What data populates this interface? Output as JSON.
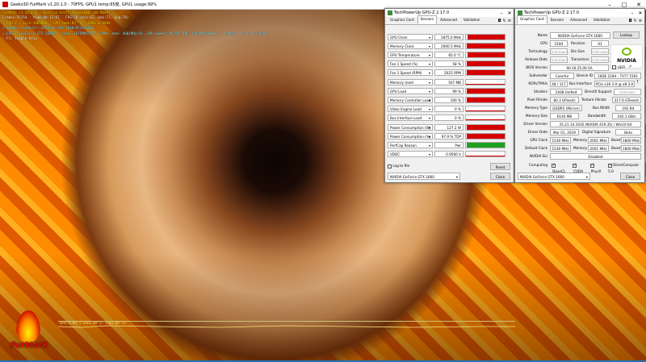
{
  "furmark": {
    "title": "Geeks3D FurMark v1.20.1.0 - 70FPS, GPU1 temp:65度, GPU1 usage:99%",
    "osd_lines": [
      {
        "text": "FurMark v1.20.1.0 - Burn-in test, 1920x1080 (0X MSAA)",
        "color": "osd-y"
      },
      {
        "text": "Frames:55154 - time:00:13:07 - FPS:70 (min:62, max:71, avg:70)",
        "color": "osd-w"
      },
      {
        "text": "[ GPU-Z ] core:1905MHz - GPU temp:65° C - VDDC:0.968V",
        "color": "osd-y"
      },
      {
        "text": "> OpenGL renderer: GeForce GTX 1660/PCIe/SSE2",
        "color": "osd-c"
      },
      {
        "text": "> GPU 1 (GeForce GTX 1660) - core: 1875MHz/65° C/99%, mem: 4001MHz/5%, GPU power: 95.5% TDP, limits[power:1, temp:0, volt:0, OV:0]",
        "color": "osd-c"
      },
      {
        "text": "- F1: toggle help",
        "color": "osd-w"
      }
    ],
    "graph_label": "GPU 1: 65° C (min: 46° C - max: 66° C)",
    "logo_text": "FurMark"
  },
  "gpuz_sensors": {
    "title": "TechPowerUp GPU-Z 2.17.0",
    "tabs": [
      "Graphics Card",
      "Sensors",
      "Advanced",
      "Validation"
    ],
    "active_tab": "Sensors",
    "rows": [
      {
        "name": "GPU Clock",
        "value": "1875.0 MHz",
        "fill": 0.95
      },
      {
        "name": "Memory Clock",
        "value": "2000.5 MHz",
        "fill": 0.97
      },
      {
        "name": "GPU Temperature",
        "value": "65.0 °C",
        "fill": 0.95
      },
      {
        "name": "Fan 1 Speed (%)",
        "value": "58 %",
        "fill": 0.97
      },
      {
        "name": "Fan 1 Speed (RPM)",
        "value": "2025 RPM",
        "fill": 0.97
      },
      {
        "name": "Memory Used",
        "value": "507 MB",
        "fill": 0.0
      },
      {
        "name": "GPU Load",
        "value": "99 %",
        "fill": 0.97
      },
      {
        "name": "Memory Controller Load",
        "value": "100 %",
        "fill": 0.97
      },
      {
        "name": "Video Engine Load",
        "value": "0 %",
        "fill": 0.0
      },
      {
        "name": "Bus Interface Load",
        "value": "0 %",
        "fill": 0.0
      },
      {
        "name": "Power Consumption (W)",
        "value": "127.2 W",
        "fill": 0.97
      },
      {
        "name": "Power Consumption (%)",
        "value": "97.9 % TDP",
        "fill": 0.97
      },
      {
        "name": "PerfCap Reason",
        "value": "Pwr",
        "fill": 0.97,
        "color": "green"
      },
      {
        "name": "VDDC",
        "value": "0.9560 V",
        "fill": 0.0
      }
    ],
    "log_to_file": "Log to file",
    "reset": "Reset",
    "gpu_select": "NVIDIA GeForce GTX 1660",
    "close": "Close"
  },
  "gpuz_card": {
    "title": "TechPowerUp GPU-Z 2.17.0",
    "tabs": [
      "Graphics Card",
      "Sensors",
      "Advanced",
      "Validation"
    ],
    "active_tab": "Graphics Card",
    "name_label": "Name",
    "name_value": "NVIDIA GeForce GTX 1660",
    "lookup": "Lookup",
    "gpu_label": "GPU",
    "gpu_value": "2184",
    "revision_label": "Revision",
    "revision_value": "A1",
    "tech_label": "Technology",
    "tech_value": "Unknown",
    "die_label": "Die Size",
    "die_value": "Unknown",
    "release_label": "Release Date",
    "release_value": "Unknown",
    "transistors_label": "Transistors",
    "transistors_value": "Unknown",
    "bios_label": "BIOS Version",
    "bios_value": "90.16.25.00.5A",
    "uefi_label": "UEFI",
    "subvendor_label": "Subvendor",
    "subvendor_value": "Colorful",
    "device_label": "Device ID",
    "device_value": "10DE 2184 - 7377 1501",
    "rops_label": "ROPs/TMUs",
    "rops_value": "48 / 117",
    "bus_label": "Bus Interface",
    "bus_value": "PCIe x16 3.0 @ x8 3.0",
    "shaders_label": "Shaders",
    "shaders_value": "1408 Unified",
    "dx_label": "DirectX Support",
    "dx_value": "Unknown",
    "pixel_label": "Pixel Fillrate",
    "pixel_value": "80.3 GPixel/s",
    "texture_label": "Texture Fillrate",
    "texture_value": "217.6 GTexel/s",
    "memtype_label": "Memory Type",
    "memtype_value": "GDDR5 (Micron)",
    "buswidth_label": "Bus Width",
    "buswidth_value": "192 Bit",
    "memsize_label": "Memory Size",
    "memsize_value": "6144 MB",
    "bandwidth_label": "Bandwidth",
    "bandwidth_value": "192.1 GB/s",
    "driver_label": "Driver Version",
    "driver_value": "25.21.14.1935 (NVIDIA 419.35) / Win10 64",
    "driverdate_label": "Driver Date",
    "driverdate_value": "Mar 01, 2019",
    "sig_label": "Digital Signature",
    "sig_value": "Beta",
    "gpuclock_label": "GPU Clock",
    "gpuclock_value": "1530 MHz",
    "memory_label": "Memory",
    "memory_value": "2001 MHz",
    "boost_label": "Boost",
    "boost_value": "1800 MHz",
    "defclock_label": "Default Clock",
    "defclock_value": "1530 MHz",
    "memory2_value": "2001 MHz",
    "boost2_value": "1800 MHz",
    "sli_label": "NVIDIA SLI",
    "sli_value": "Disabled",
    "computing_label": "Computing",
    "computing": [
      "OpenCL",
      "CUDA",
      "PhysX",
      "DirectCompute 5.0"
    ],
    "gpu_select": "NVIDIA GeForce GTX 1660",
    "close": "Close",
    "nvidia_logo": "NVIDIA"
  }
}
